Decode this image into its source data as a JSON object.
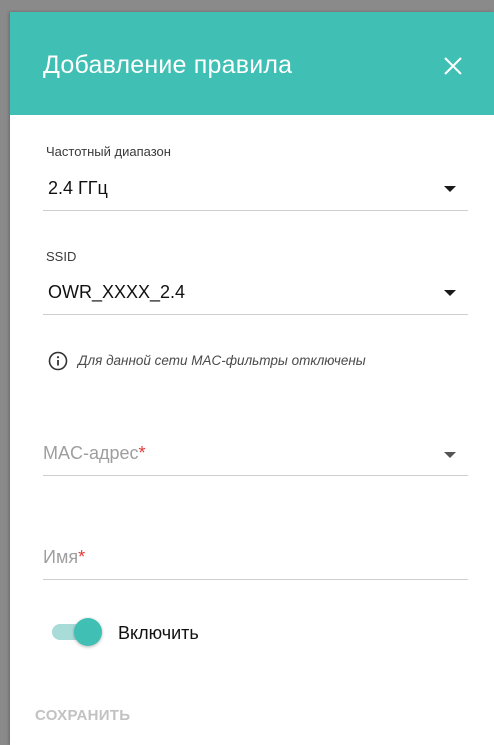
{
  "dialog": {
    "title": "Добавление правила",
    "close_icon": "close-icon"
  },
  "form": {
    "band": {
      "label": "Частотный диапазон",
      "value": "2.4 ГГц"
    },
    "ssid": {
      "label": "SSID",
      "value": "OWR_XXXX_2.4"
    },
    "info": {
      "icon": "info-icon",
      "text": "Для данной сети MAC-фильтры отключены"
    },
    "mac": {
      "placeholder": "MAC-адрес",
      "required_mark": "*"
    },
    "name": {
      "placeholder": "Имя",
      "required_mark": "*"
    },
    "enable": {
      "label": "Включить",
      "checked": true
    }
  },
  "actions": {
    "save_label": "СОХРАНИТЬ"
  },
  "colors": {
    "accent": "#40bfb4",
    "toggle_track": "#a9dcd9",
    "required": "#e53935",
    "disabled_text": "#c2c2c2"
  }
}
